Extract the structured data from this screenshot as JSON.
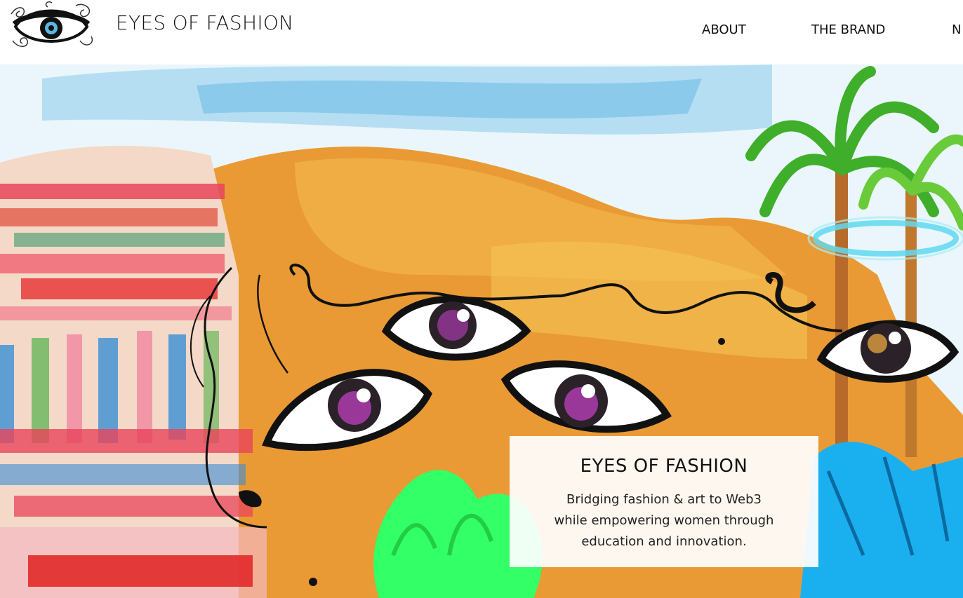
{
  "header": {
    "site_title": "EYES OF FASHION",
    "logo_icon": "eye-logo-icon"
  },
  "nav": {
    "items": [
      {
        "label": "ABOUT"
      },
      {
        "label": "THE BRAND"
      },
      {
        "label": "N"
      }
    ]
  },
  "hero": {
    "artwork": "watercolor painting of eyes with palm trees",
    "card": {
      "title": "EYES OF FASHION",
      "line1": "Bridging fashion & art to Web3",
      "line2": "while empowering women through",
      "line3": "education and innovation."
    }
  },
  "colors": {
    "text": "#111111",
    "sky": "#7ec8e8",
    "sand": "#e89a3a",
    "iris": "#c040c0",
    "halo": "#5fd8f0",
    "palm": "#3fae2a",
    "neon_green": "#33ff66",
    "blue_shape": "#1ab0ef"
  }
}
